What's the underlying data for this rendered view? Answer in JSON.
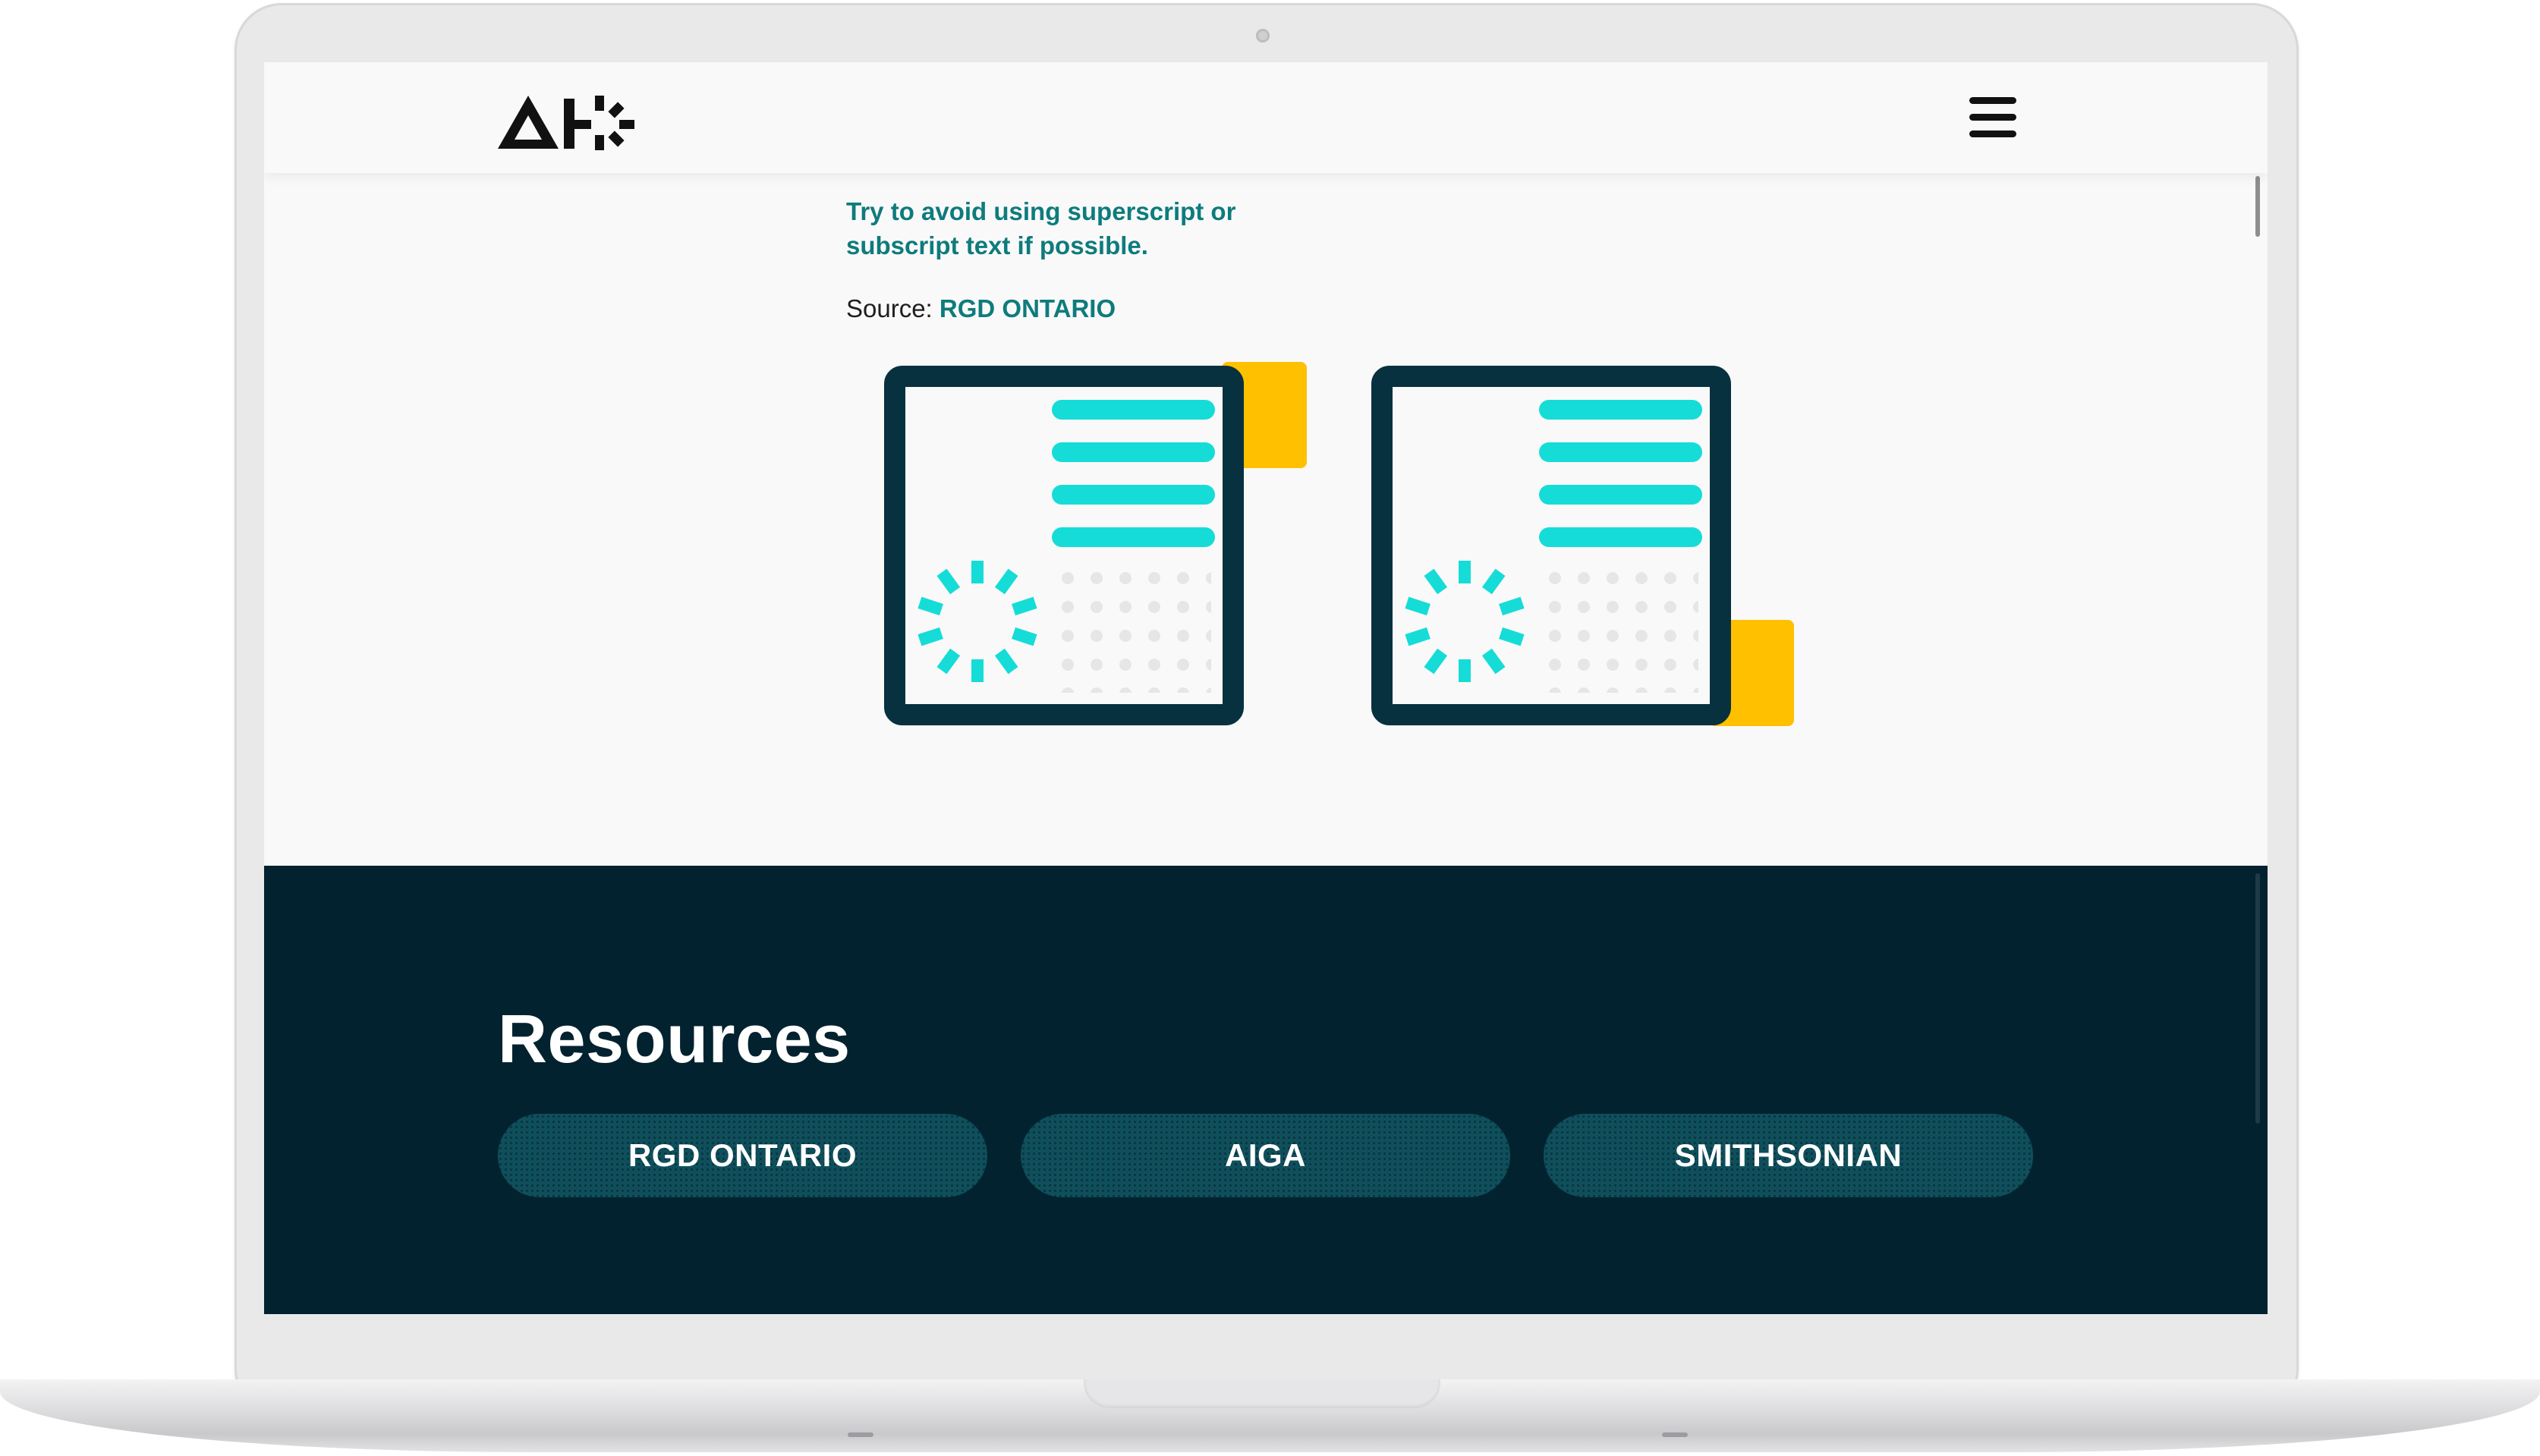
{
  "content": {
    "tip": "Try to avoid using superscript or subscript text if possible.",
    "source_label": "Source:",
    "source_link": "RGD ONTARIO"
  },
  "footer": {
    "title": "Resources",
    "links": [
      "RGD ONTARIO",
      "AIGA",
      "SMITHSONIAN"
    ]
  },
  "icons": {
    "logo": "ah-logo",
    "menu": "hamburger-menu-icon"
  },
  "colors": {
    "accent_teal": "#0e7b7c",
    "cyan": "#16dcd8",
    "yellow": "#ffc000",
    "navy": "#03222f",
    "pill": "#0f4f5c"
  }
}
